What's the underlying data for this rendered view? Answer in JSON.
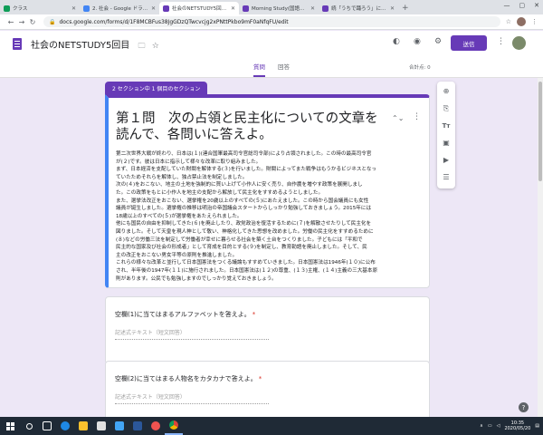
{
  "browser": {
    "tabs": [
      {
        "title": "クラス",
        "active": false,
        "color": "#0f9d58"
      },
      {
        "title": "2. 社会 - Google ドライブ",
        "active": false,
        "color": "#4285f4"
      },
      {
        "title": "社会のNETSTUDY5回目 - G...",
        "active": true,
        "color": "#673ab7"
      },
      {
        "title": "Morning Study(国語編) 第...",
        "active": false,
        "color": "#673ab7"
      },
      {
        "title": "続「うちで踊ろう」にチャレンジ!...",
        "active": false,
        "color": "#673ab7"
      }
    ],
    "url": "docs.google.com/forms/d/1F8MCBFus38JgGDzQTwcvcjg2xPNttPkbo9mF0aNfqFU/edit"
  },
  "header": {
    "title": "社会のNETSTUDY5回目",
    "send_label": "送信",
    "tab_questions": "質問",
    "tab_responses": "回答",
    "total_score": "合計点: 0",
    "accent": "#673ab7"
  },
  "section": {
    "label": "2 セクション中 1 個目のセクション",
    "title": "第１問　次の占領と民主化についての文章を読んで、各問いに答えよ。",
    "lines": [
      "第二次世界大戦が終わり、日本は(１)(連合国軍最高司令官総司令部)により占領されました。この時の最高司令官",
      "が(２)です。彼は日本に指示して様々な改革に取り組みました。",
      "まず、日本経済を支配していた財閥を解体する(３)を行いました。財閥によってまた戦争はもうかるビジネスとなっ",
      "ていたためそれらを解体し、独占禁止法を制定しました。",
      "次の(４)をおこない、地主の土地を強制的に買い上げて小作人に安く売り、自作農を増やす政策を展開しまし",
      "た。この政策をもとに小作人を地主の支配から解放して民主化をすすめるようとしました。",
      "また、選挙法改正をおこない、選挙権を20歳以上のすべての(５)にあたえました。この時から国会議員にも女性",
      "議員が誕生しました。選挙権の推移は明治の帝国議会スタートからしっかり勉強しておきましょう。2015年には",
      "18歳以上のすべての(５)が選挙権をあたえられました。",
      "他にも国民の自由を抑制してきた(６)を廃止したり、政党政治を復活するために(７)を解散させたりして民主化を",
      "図りました。そして天皇を現人神として敬い、神格化してきた思想を改めました。労働の民主化をすすめるために",
      "(８)などの労働三法を制定して労働者が幸せに暮らせる社会を築く土台をつくりました。子どもには「平和で",
      "民主的な国家及び社会の形成者」として育成を目的とする(９)を制定し、教育勅語を廃止しました。そして、民",
      "主の改正をおこない男女平等の原則を推進しました。",
      "これらの様々な改革と並行して日本国憲法をつくる議論もすすめていきました。日本国憲法は1946年(１０)に公布",
      "され、半年後の1947年(１１)に施行されました。日本国憲法は(１２)の尊重、(１３)主権、(１４)主義の三大基本原",
      "則があります。公民でも勉強しますのでしっかり覚えておきましょう。"
    ]
  },
  "questions": [
    {
      "label": "空欄(1)に当てはまるアルファベットを答えよ。",
      "required": "*",
      "placeholder": "記述式テキスト（短文回答）"
    },
    {
      "label": "空欄(2)に当てはまる人物名をカタカナで答えよ。",
      "required": "*",
      "placeholder": "記述式テキスト（短文回答）"
    }
  ],
  "taskbar": {
    "time": "10:35",
    "date": "2020/05/20"
  }
}
